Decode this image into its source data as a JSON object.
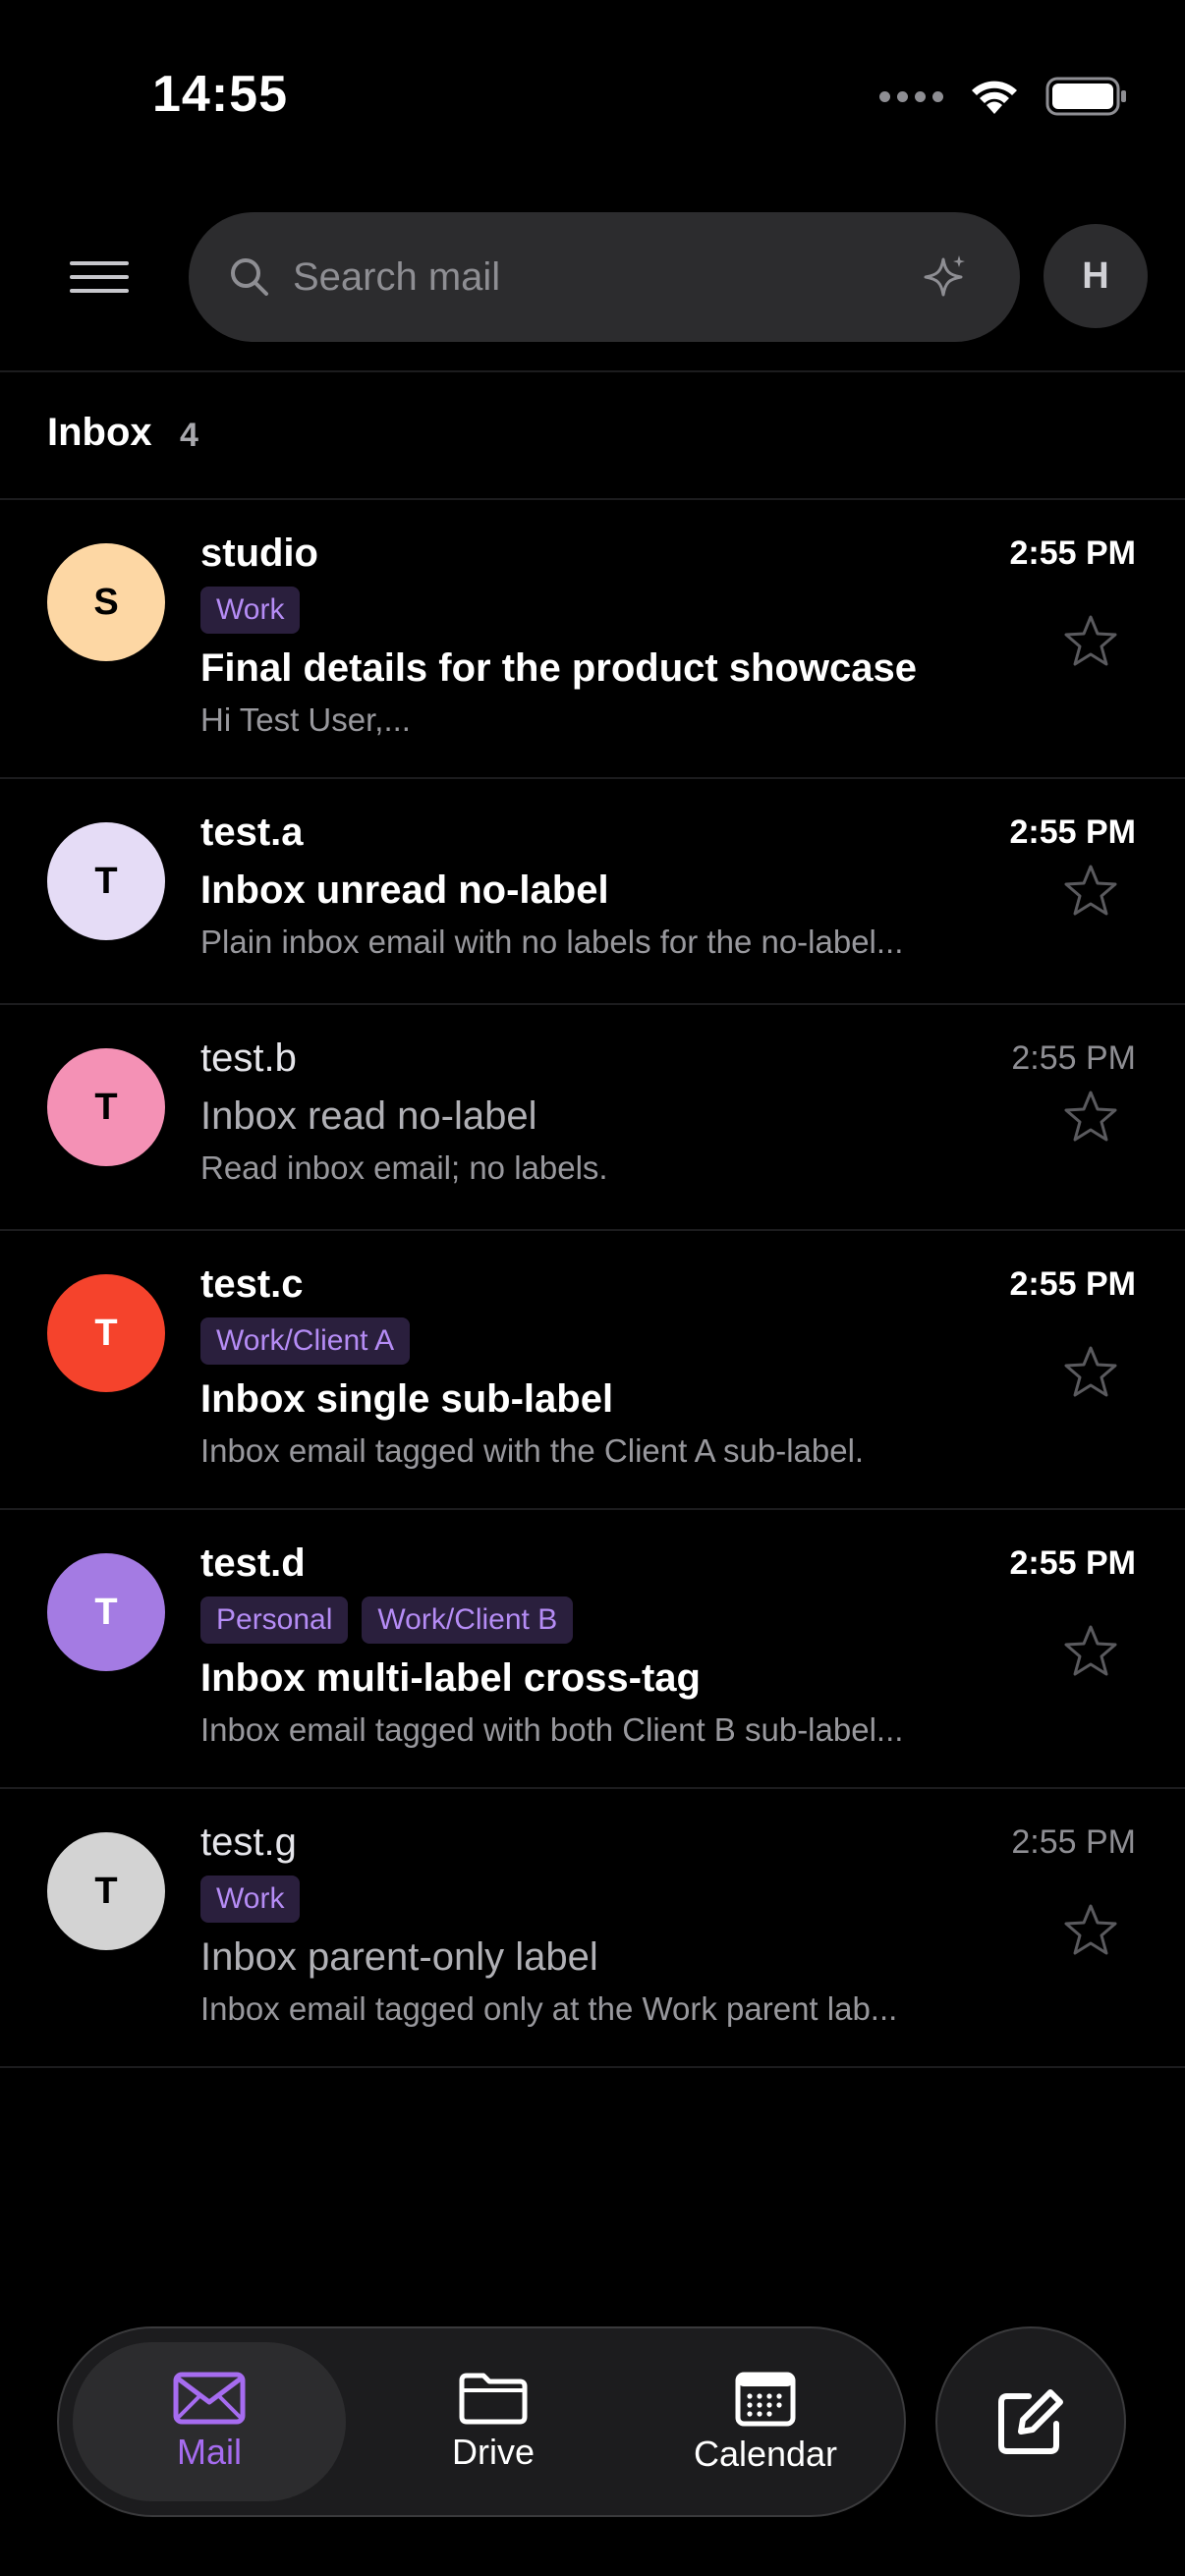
{
  "status_bar": {
    "time": "14:55"
  },
  "search": {
    "placeholder": "Search mail"
  },
  "account": {
    "initial": "H"
  },
  "inbox": {
    "title": "Inbox",
    "count": "4"
  },
  "colors": {
    "accent": "#a66cf0",
    "label_bg": "#2a1f3d",
    "label_text": "#b58cf5"
  },
  "emails": [
    {
      "sender": "studio",
      "initial": "S",
      "avatar_color": "#fdd7a4",
      "avatar_text_color": "#000000",
      "time": "2:55 PM",
      "labels": [
        "Work"
      ],
      "subject": "Final details for the product showcase",
      "snippet": "Hi Test User,...",
      "unread": true,
      "starred": false
    },
    {
      "sender": "test.a",
      "initial": "T",
      "avatar_color": "#e5dcf6",
      "avatar_text_color": "#000000",
      "time": "2:55 PM",
      "labels": [],
      "subject": "Inbox unread no-label",
      "snippet": "Plain inbox email with no labels for the no-label...",
      "unread": true,
      "starred": false
    },
    {
      "sender": "test.b",
      "initial": "T",
      "avatar_color": "#f491b5",
      "avatar_text_color": "#000000",
      "time": "2:55 PM",
      "labels": [],
      "subject": "Inbox read no-label",
      "snippet": "Read inbox email; no labels.",
      "unread": false,
      "starred": false
    },
    {
      "sender": "test.c",
      "initial": "T",
      "avatar_color": "#f5432c",
      "avatar_text_color": "#ffffff",
      "time": "2:55 PM",
      "labels": [
        "Work/Client A"
      ],
      "subject": "Inbox single sub-label",
      "snippet": "Inbox email tagged with the Client A sub-label.",
      "unread": true,
      "starred": false
    },
    {
      "sender": "test.d",
      "initial": "T",
      "avatar_color": "#a47be3",
      "avatar_text_color": "#ffffff",
      "time": "2:55 PM",
      "labels": [
        "Personal",
        "Work/Client B"
      ],
      "subject": "Inbox multi-label cross-tag",
      "snippet": "Inbox email tagged with both Client B sub-label...",
      "unread": true,
      "starred": false
    },
    {
      "sender": "test.g",
      "initial": "T",
      "avatar_color": "#d3d3d3",
      "avatar_text_color": "#000000",
      "time": "2:55 PM",
      "labels": [
        "Work"
      ],
      "subject": "Inbox parent-only label",
      "snippet": "Inbox email tagged only at the Work parent lab...",
      "unread": false,
      "starred": false
    }
  ],
  "tabs": [
    {
      "label": "Mail",
      "icon": "mail-icon",
      "active": true
    },
    {
      "label": "Drive",
      "icon": "folder-icon",
      "active": false
    },
    {
      "label": "Calendar",
      "icon": "calendar-icon",
      "active": false
    }
  ],
  "compose": {
    "icon": "compose-icon"
  }
}
